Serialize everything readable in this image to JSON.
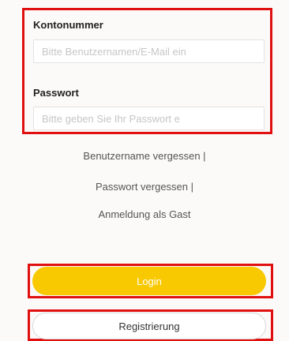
{
  "form": {
    "account_label": "Kontonummer",
    "account_placeholder": "Bitte Benutzernamen/E-Mail ein",
    "password_label": "Passwort",
    "password_placeholder": "Bitte geben Sie Ihr Passwort e"
  },
  "links": {
    "forgot_username": "Benutzername vergessen  |",
    "forgot_password": "Passwort vergessen  |",
    "guest_login": "Anmeldung als Gast"
  },
  "buttons": {
    "login": "Login",
    "register": "Registrierung"
  },
  "colors": {
    "highlight": "#e01010",
    "login_button": "#f8c800"
  }
}
